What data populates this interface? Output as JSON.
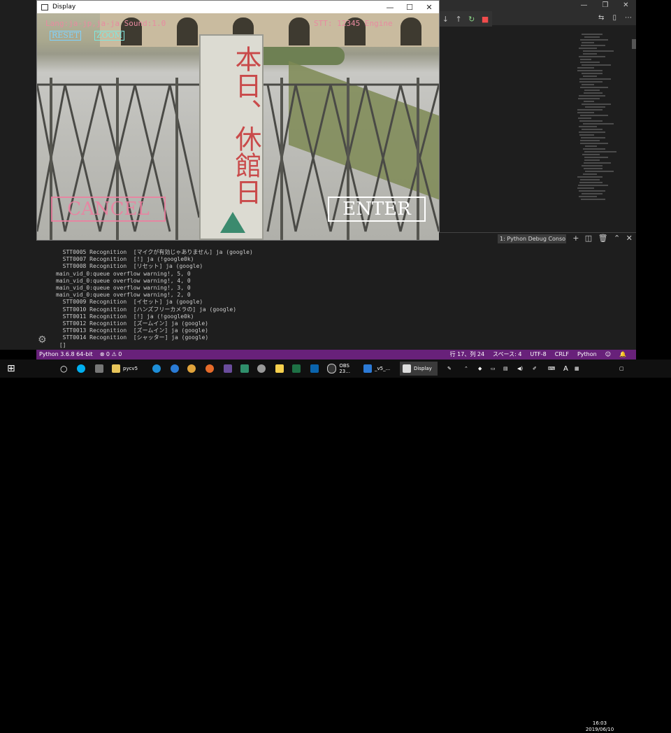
{
  "display_window": {
    "title": "Display",
    "min": "—",
    "max": "☐",
    "close": "✕"
  },
  "overlay": {
    "lang_line": "Lang:ja-jp,ja-ja  Sound:1.0",
    "stt_line": "STT: 12345  Engine",
    "reset_label": "RESET",
    "zoom_label": "ZOOM",
    "cancel_label": "CANCEL",
    "enter_label": "ENTER",
    "sign_text": "本日、休館日"
  },
  "terminal": {
    "selector_label": "1: Python Debug Conso",
    "lines": [
      "  STT0005 Recognition  [マイクが有効じゃありません] ja (google)",
      "  STT0007 Recognition  [!] ja (!google0k)",
      "  STT0008 Recognition  [リセット] ja (google)",
      "main_vid_0:queue overflow warning!, 5, 0",
      "main_vid_0:queue overflow warning!, 4, 0",
      "main_vid_0:queue overflow warning!, 3, 0",
      "main_vid_0:queue overflow warning!, 2, 0",
      "  STT0009 Recognition  [イセット] ja (google)",
      "  STT0010 Recognition  [ハンズフリーカメラの] ja (google)",
      "  STT0011 Recognition  [!] ja (!google0k)",
      "  STT0012 Recognition  [ズームイン] ja (google)",
      "  STT0013 Recognition  [ズームイン] ja (google)",
      "  STT0014 Recognition  [シャッター] ja (google)",
      " []"
    ]
  },
  "statusbar": {
    "python_version": "Python 3.6.8 64-bit",
    "problems": "⊗ 0 ⚠ 0",
    "position": "行 17、列 24",
    "spaces": "スペース: 4",
    "encoding": "UTF-8",
    "eol": "CRLF",
    "language": "Python"
  },
  "taskbar": {
    "items": [
      {
        "label": "pycv5"
      },
      {
        "label": "OBS 23..."
      },
      {
        "label": "_v5_..."
      },
      {
        "label": "Display"
      }
    ],
    "time": "16:03",
    "date": "2019/06/10",
    "ime": "A"
  },
  "colors": {
    "statusbar": "#68217a",
    "cancel": "#f07ea0",
    "enter": "#ffffff",
    "overlay_text": "#e88aa0"
  }
}
